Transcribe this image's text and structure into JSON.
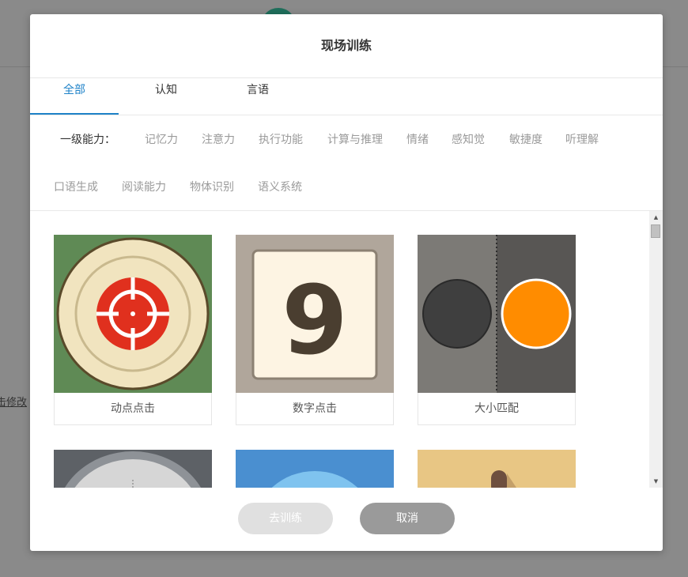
{
  "background": {
    "link_text": "点击修改"
  },
  "modal": {
    "title": "现场训练"
  },
  "tabs": [
    {
      "label": "全部",
      "active": true
    },
    {
      "label": "认知",
      "active": false
    },
    {
      "label": "言语",
      "active": false
    }
  ],
  "filters": {
    "label": "一级能力：",
    "row1": [
      "记忆力",
      "注意力",
      "执行功能",
      "计算与推理",
      "情绪",
      "感知觉",
      "敏捷度",
      "听理解"
    ],
    "row2": [
      "口语生成",
      "阅读能力",
      "物体识别",
      "语义系统"
    ]
  },
  "cards": [
    {
      "label": "动点点击",
      "icon": "target-icon"
    },
    {
      "label": "数字点击",
      "icon": "number-tile-icon",
      "number": "9"
    },
    {
      "label": "大小匹配",
      "icon": "size-match-icon"
    }
  ],
  "buttons": {
    "train": "去训练",
    "cancel": "取消"
  },
  "colors": {
    "accent": "#1e82c8",
    "overlay": "#8a8a8a",
    "target_red": "#e0301e",
    "orange": "#ff8c00"
  }
}
